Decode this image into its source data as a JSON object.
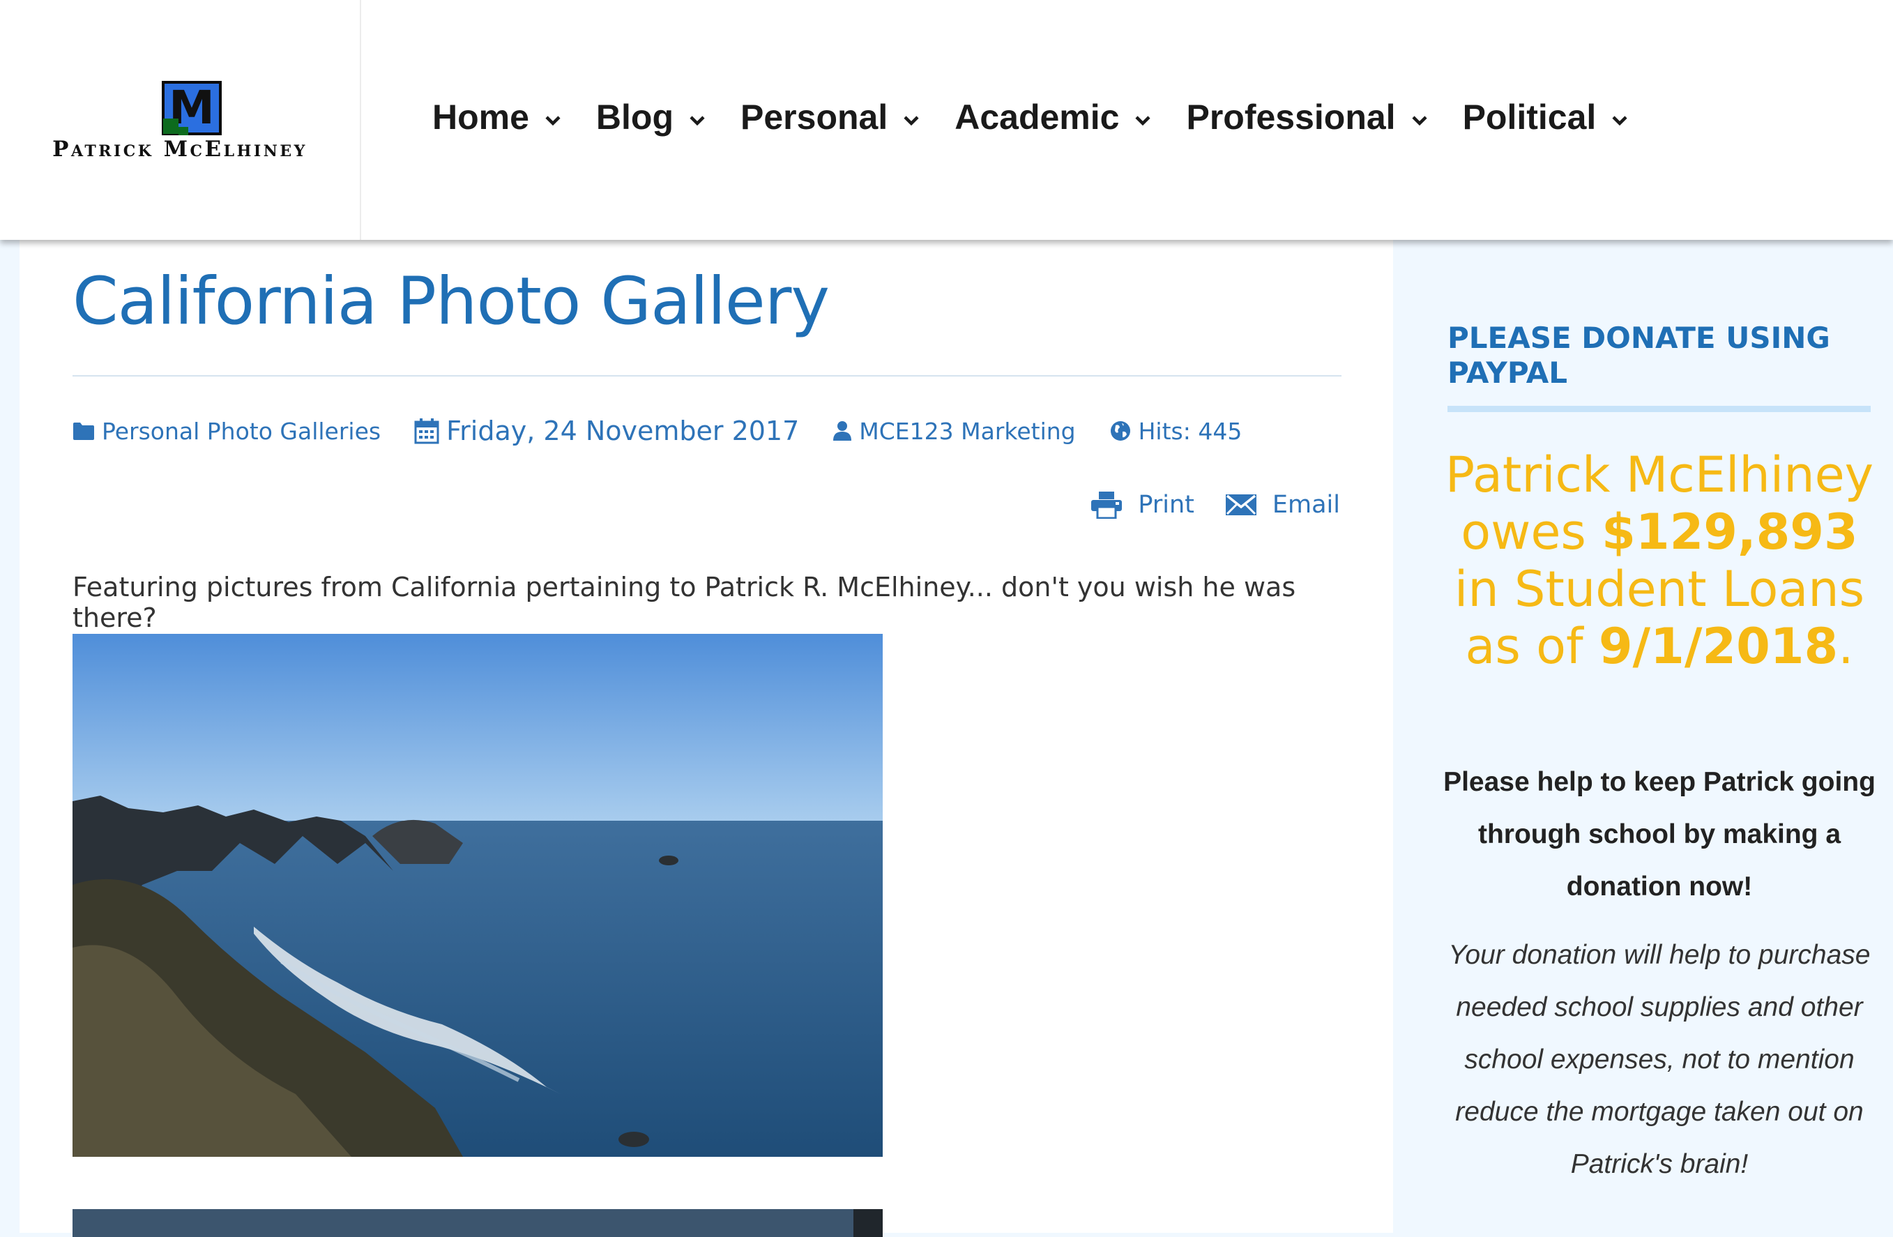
{
  "site": {
    "logo_letter": "M",
    "logo_text": "Patrick McElhiney"
  },
  "nav": {
    "items": [
      {
        "label": "Home"
      },
      {
        "label": "Blog"
      },
      {
        "label": "Personal"
      },
      {
        "label": "Academic"
      },
      {
        "label": "Professional"
      },
      {
        "label": "Political"
      }
    ]
  },
  "article": {
    "title": "California Photo Gallery",
    "category": "Personal Photo Galleries",
    "date": "Friday, 24 November 2017",
    "author": "MCE123 Marketing",
    "hits": "Hits: 445",
    "print_label": "Print",
    "email_label": "Email",
    "intro": "Featuring pictures from California pertaining to Patrick R. McElhiney... don't you wish he was there?"
  },
  "sidebar": {
    "heading": "PLEASE DONATE USING PAYPAL",
    "owes_pre": "Patrick McElhiney owes ",
    "amount": "$129,893",
    "owes_mid": " in Student Loans as of ",
    "as_of_date": "9/1/2018",
    "owes_end": ".",
    "help_text": "Please help to keep Patrick going through school by making a donation now!",
    "pitch_text": "Your donation will help to purchase needed school supplies and other school expenses, not to mention reduce the mortgage taken out on Patrick's brain!"
  },
  "colors": {
    "accent_blue": "#1f6fb5",
    "link_blue": "#2e73b8",
    "donate_gold": "#f6b915",
    "sidebar_bg": "#f0f8ff"
  }
}
